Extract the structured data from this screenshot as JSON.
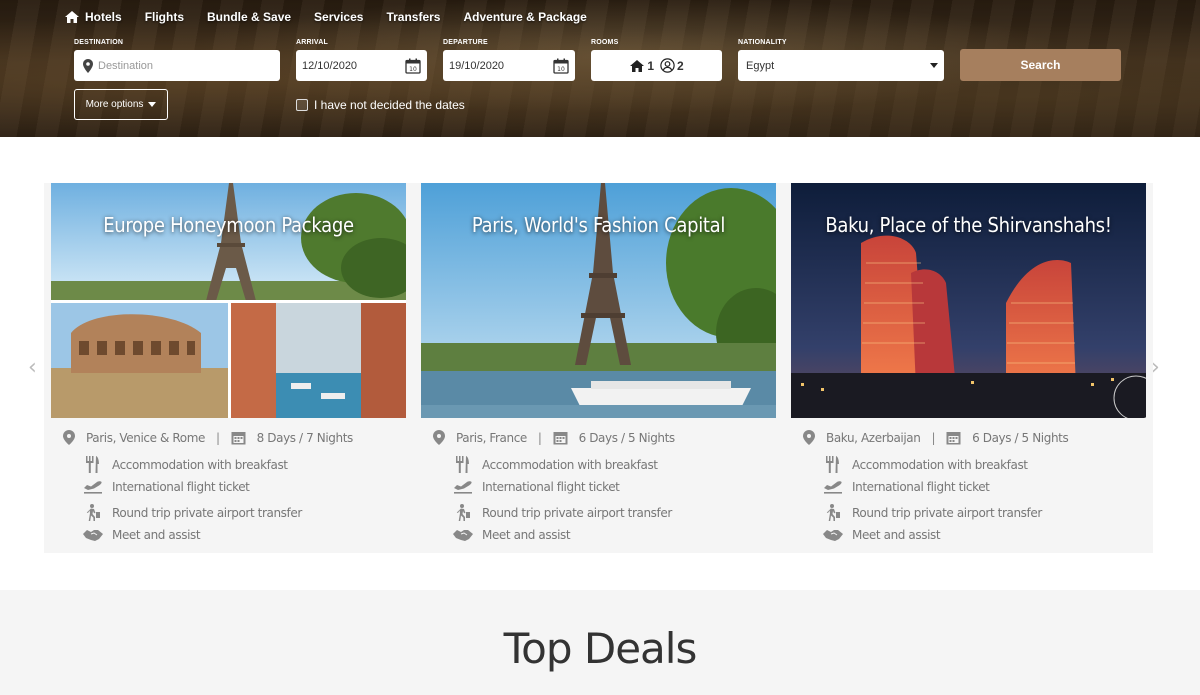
{
  "nav": {
    "items": [
      {
        "label": "Hotels",
        "icon": "home-icon"
      },
      {
        "label": "Flights"
      },
      {
        "label": "Bundle & Save"
      },
      {
        "label": "Services"
      },
      {
        "label": "Transfers"
      },
      {
        "label": "Adventure & Package"
      }
    ]
  },
  "search": {
    "destination_label": "DESTINATION",
    "destination_placeholder": "Destination",
    "arrival_label": "ARRIVAL",
    "arrival_value": "12/10/2020",
    "departure_label": "DEPARTURE",
    "departure_value": "19/10/2020",
    "rooms_label": "ROOMS",
    "rooms_count": "1",
    "guests_count": "2",
    "nationality_label": "NATIONALITY",
    "nationality_value": "Egypt",
    "search_label": "Search",
    "more_options_label": "More options",
    "undecided_label": "I have not decided the dates",
    "accent_color": "#a67f5e"
  },
  "packages": [
    {
      "title": "Europe Honeymoon Package",
      "location": "Paris, Venice & Rome",
      "duration": "8 Days / 7 Nights",
      "features": [
        "Accommodation with breakfast",
        "International flight ticket",
        "Round trip private airport transfer",
        "Meet and assist"
      ]
    },
    {
      "title": "Paris, World's Fashion Capital",
      "location": "Paris, France",
      "duration": "6 Days / 5 Nights",
      "features": [
        "Accommodation with breakfast",
        "International flight ticket",
        "Round trip private airport transfer",
        "Meet and assist"
      ]
    },
    {
      "title": "Baku, Place of the Shirvanshahs!",
      "location": "Baku, Azerbaijan",
      "duration": "6 Days / 5 Nights",
      "features": [
        "Accommodation with breakfast",
        "International flight ticket",
        "Round trip private airport transfer",
        "Meet and assist"
      ]
    }
  ],
  "deals": {
    "title": "Top Deals"
  }
}
